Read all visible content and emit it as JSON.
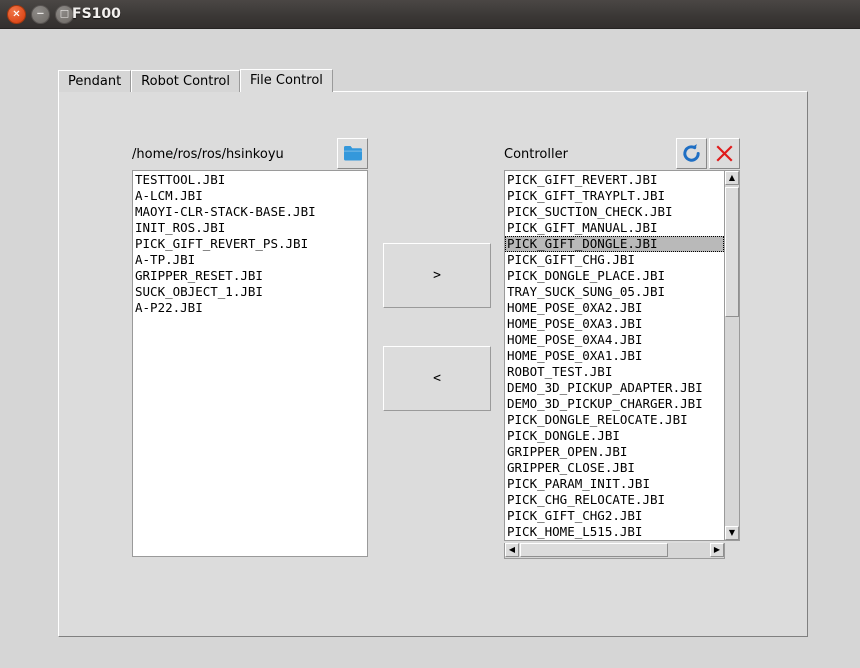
{
  "window": {
    "title": "FS100",
    "buttons": [
      {
        "name": "close",
        "glyph": "×"
      },
      {
        "name": "minimize",
        "glyph": "−"
      },
      {
        "name": "maximize",
        "glyph": "□"
      }
    ]
  },
  "tabs": [
    {
      "label": "Pendant",
      "active": false
    },
    {
      "label": "Robot Control",
      "active": false
    },
    {
      "label": "File Control",
      "active": true
    }
  ],
  "left_panel": {
    "path_label": "/home/ros/ros/hsinkoyu",
    "browse_icon": "folder-icon",
    "files": [
      "TESTTOOL.JBI",
      "A-LCM.JBI",
      "MAOYI-CLR-STACK-BASE.JBI",
      "INIT_ROS.JBI",
      "PICK_GIFT_REVERT_PS.JBI",
      "A-TP.JBI",
      "GRIPPER_RESET.JBI",
      "SUCK_OBJECT_1.JBI",
      "A-P22.JBI"
    ],
    "selected_index": -1
  },
  "transfer": {
    "to_controller_label": ">",
    "to_local_label": "<"
  },
  "right_panel": {
    "label": "Controller",
    "refresh_icon": "refresh-icon",
    "delete_icon": "delete-icon",
    "files": [
      "PICK_GIFT_REVERT.JBI",
      "PICK_GIFT_TRAYPLT.JBI",
      "PICK_SUCTION_CHECK.JBI",
      "PICK_GIFT_MANUAL.JBI",
      "PICK_GIFT_DONGLE.JBI",
      "PICK_GIFT_CHG.JBI",
      "PICK_DONGLE_PLACE.JBI",
      "TRAY_SUCK_SUNG_05.JBI",
      "HOME_POSE_0XA2.JBI",
      "HOME_POSE_0XA3.JBI",
      "HOME_POSE_0XA4.JBI",
      "HOME_POSE_0XA1.JBI",
      "ROBOT_TEST.JBI",
      "DEMO_3D_PICKUP_ADAPTER.JBI",
      "DEMO_3D_PICKUP_CHARGER.JBI",
      "PICK_DONGLE_RELOCATE.JBI",
      "PICK_DONGLE.JBI",
      "GRIPPER_OPEN.JBI",
      "GRIPPER_CLOSE.JBI",
      "PICK_PARAM_INIT.JBI",
      "PICK_CHG_RELOCATE.JBI",
      "PICK_GIFT_CHG2.JBI",
      "PICK_HOME_L515.JBI"
    ],
    "selected_index": 4,
    "scroll": {
      "vertical_arrow_up": "▲",
      "vertical_arrow_down": "▼",
      "horizontal_arrow_left": "◀",
      "horizontal_arrow_right": "▶"
    }
  },
  "colors": {
    "titlebar": "#3b3836",
    "window_bg": "#d6d6d6",
    "panel_bg": "#dcdcdc",
    "list_bg": "#ffffff",
    "selection": "#b9b9b9",
    "folder_blue": "#3498db",
    "refresh_blue": "#1f6fc4",
    "delete_red": "#e01b1b",
    "close_orange": "#df4b1c"
  }
}
